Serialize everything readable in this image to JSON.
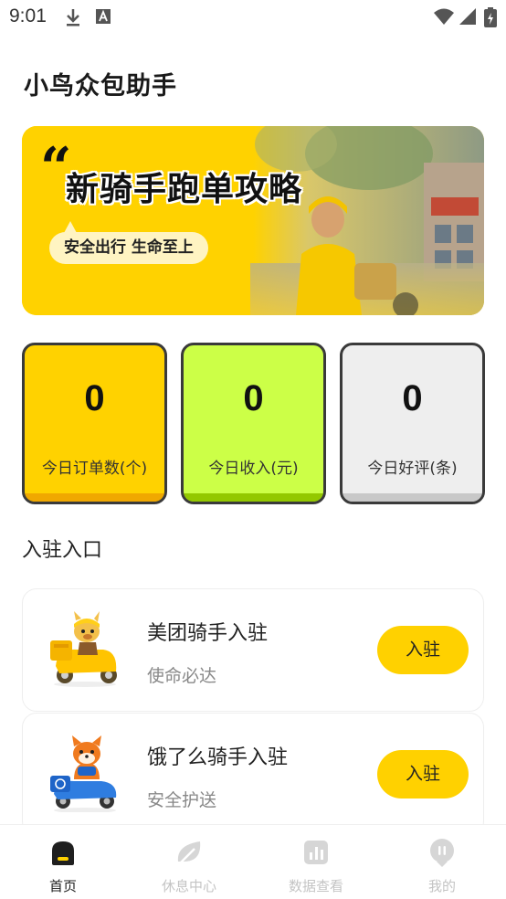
{
  "status_bar": {
    "time": "9:01"
  },
  "app": {
    "title": "小鸟众包助手"
  },
  "banner": {
    "quote_mark": "“",
    "title": "新骑手跑单攻略",
    "slogan": "安全出行 生命至上"
  },
  "stats": [
    {
      "value": "0",
      "label": "今日订单数(个)",
      "color": "#ffd200",
      "strip": "#f0a800"
    },
    {
      "value": "0",
      "label": "今日收入(元)",
      "color": "#ccff47",
      "strip": "#93c800"
    },
    {
      "value": "0",
      "label": "今日好评(条)",
      "color": "#eeeeee",
      "strip": "#c8c8c8"
    }
  ],
  "section": {
    "title": "入驻入口"
  },
  "entries": [
    {
      "name": "美团骑手入驻",
      "desc": "使命必达",
      "button": "入驻",
      "mascot": "kangaroo-scooter-icon"
    },
    {
      "name": "饿了么骑手入驻",
      "desc": "安全护送",
      "button": "入驻",
      "mascot": "fox-scooter-icon"
    }
  ],
  "tabs": [
    {
      "label": "首页",
      "icon": "home-icon",
      "active": true
    },
    {
      "label": "休息中心",
      "icon": "leaf-icon",
      "active": false
    },
    {
      "label": "数据查看",
      "icon": "chart-icon",
      "active": false
    },
    {
      "label": "我的",
      "icon": "profile-icon",
      "active": false
    }
  ],
  "colors": {
    "accent": "#ffd100",
    "text": "#222222",
    "muted": "#888888"
  }
}
